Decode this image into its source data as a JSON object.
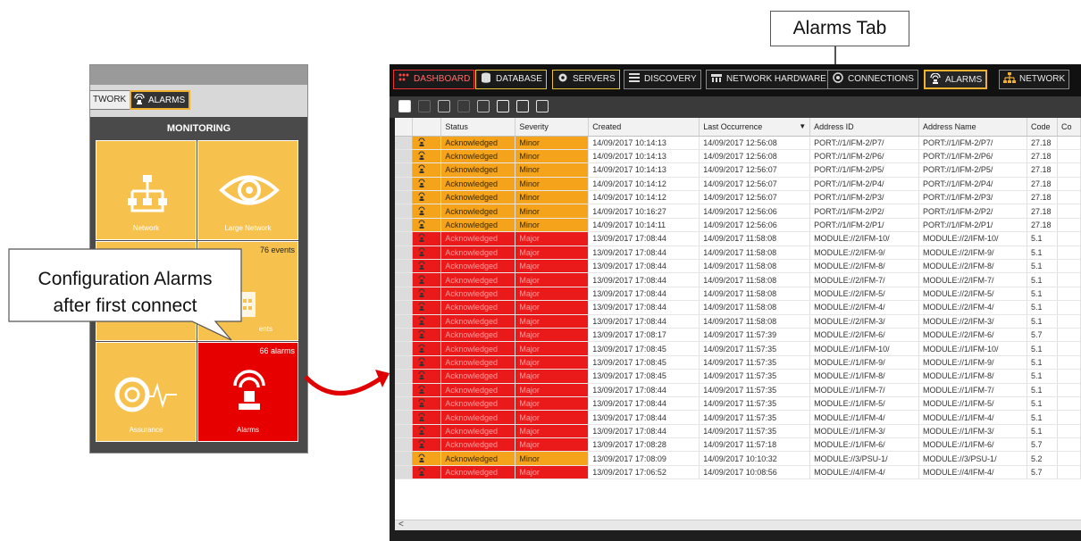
{
  "callouts": {
    "alarms_tab": "Alarms Tab",
    "config_alarms_line1": "Configuration Alarms",
    "config_alarms_line2": "after first connect"
  },
  "left_panel": {
    "tabs": {
      "network": "TWORK",
      "alarms": "ALARMS"
    },
    "section_title": "MONITORING",
    "tiles": [
      {
        "label": "Network",
        "count": "",
        "icon": "network-tree-icon"
      },
      {
        "label": "Large Network",
        "count": "",
        "icon": "eye-icon"
      },
      {
        "label": "",
        "count": "76 events",
        "icon": "calendar-icon"
      },
      {
        "label": "ents",
        "count": "",
        "icon": ""
      },
      {
        "label": "Assurance",
        "count": "",
        "icon": "tire-pulse-icon"
      },
      {
        "label": "Alarms",
        "count": "66 alarms",
        "icon": "siren-icon"
      }
    ]
  },
  "app": {
    "nav": [
      {
        "label": "DASHBOARD",
        "icon": "dashboard-icon"
      },
      {
        "label": "DATABASE",
        "icon": "database-icon"
      },
      {
        "label": "SERVERS",
        "icon": "gear-icon"
      },
      {
        "label": "DISCOVERY",
        "icon": "list-icon"
      },
      {
        "label": "NETWORK HARDWARE",
        "icon": "rack-icon"
      },
      {
        "label": "CONNECTIONS",
        "icon": "connection-icon"
      },
      {
        "label": "ALARMS",
        "icon": "siren-icon"
      },
      {
        "label": "NETWORK",
        "icon": "network-icon"
      }
    ],
    "active_tab": "ALARMS",
    "colors": {
      "minor": "#f5a31a",
      "major": "#ea1a1a",
      "active_border": "#f0b030"
    },
    "table": {
      "columns": [
        "",
        "Status",
        "Severity",
        "Created",
        "Last Occurrence",
        "Address ID",
        "Address Name",
        "Code",
        "Co"
      ],
      "sort_column": "Last Occurrence",
      "rows": [
        [
          "Acknowledged",
          "Minor",
          "14/09/2017 10:14:13",
          "14/09/2017 12:56:08",
          "PORT://1/IFM-2/P7/",
          "PORT://1/IFM-2/P7/",
          "27.18"
        ],
        [
          "Acknowledged",
          "Minor",
          "14/09/2017 10:14:13",
          "14/09/2017 12:56:08",
          "PORT://1/IFM-2/P6/",
          "PORT://1/IFM-2/P6/",
          "27.18"
        ],
        [
          "Acknowledged",
          "Minor",
          "14/09/2017 10:14:13",
          "14/09/2017 12:56:07",
          "PORT://1/IFM-2/P5/",
          "PORT://1/IFM-2/P5/",
          "27.18"
        ],
        [
          "Acknowledged",
          "Minor",
          "14/09/2017 10:14:12",
          "14/09/2017 12:56:07",
          "PORT://1/IFM-2/P4/",
          "PORT://1/IFM-2/P4/",
          "27.18"
        ],
        [
          "Acknowledged",
          "Minor",
          "14/09/2017 10:14:12",
          "14/09/2017 12:56:07",
          "PORT://1/IFM-2/P3/",
          "PORT://1/IFM-2/P3/",
          "27.18"
        ],
        [
          "Acknowledged",
          "Minor",
          "14/09/2017 10:16:27",
          "14/09/2017 12:56:06",
          "PORT://1/IFM-2/P2/",
          "PORT://1/IFM-2/P2/",
          "27.18"
        ],
        [
          "Acknowledged",
          "Minor",
          "14/09/2017 10:14:11",
          "14/09/2017 12:56:06",
          "PORT://1/IFM-2/P1/",
          "PORT://1/IFM-2/P1/",
          "27.18"
        ],
        [
          "Acknowledged",
          "Major",
          "13/09/2017 17:08:44",
          "14/09/2017 11:58:08",
          "MODULE://2/IFM-10/",
          "MODULE://2/IFM-10/",
          "5.1"
        ],
        [
          "Acknowledged",
          "Major",
          "13/09/2017 17:08:44",
          "14/09/2017 11:58:08",
          "MODULE://2/IFM-9/",
          "MODULE://2/IFM-9/",
          "5.1"
        ],
        [
          "Acknowledged",
          "Major",
          "13/09/2017 17:08:44",
          "14/09/2017 11:58:08",
          "MODULE://2/IFM-8/",
          "MODULE://2/IFM-8/",
          "5.1"
        ],
        [
          "Acknowledged",
          "Major",
          "13/09/2017 17:08:44",
          "14/09/2017 11:58:08",
          "MODULE://2/IFM-7/",
          "MODULE://2/IFM-7/",
          "5.1"
        ],
        [
          "Acknowledged",
          "Major",
          "13/09/2017 17:08:44",
          "14/09/2017 11:58:08",
          "MODULE://2/IFM-5/",
          "MODULE://2/IFM-5/",
          "5.1"
        ],
        [
          "Acknowledged",
          "Major",
          "13/09/2017 17:08:44",
          "14/09/2017 11:58:08",
          "MODULE://2/IFM-4/",
          "MODULE://2/IFM-4/",
          "5.1"
        ],
        [
          "Acknowledged",
          "Major",
          "13/09/2017 17:08:44",
          "14/09/2017 11:58:08",
          "MODULE://2/IFM-3/",
          "MODULE://2/IFM-3/",
          "5.1"
        ],
        [
          "Acknowledged",
          "Major",
          "13/09/2017 17:08:17",
          "14/09/2017 11:57:39",
          "MODULE://2/IFM-6/",
          "MODULE://2/IFM-6/",
          "5.7"
        ],
        [
          "Acknowledged",
          "Major",
          "13/09/2017 17:08:45",
          "14/09/2017 11:57:35",
          "MODULE://1/IFM-10/",
          "MODULE://1/IFM-10/",
          "5.1"
        ],
        [
          "Acknowledged",
          "Major",
          "13/09/2017 17:08:45",
          "14/09/2017 11:57:35",
          "MODULE://1/IFM-9/",
          "MODULE://1/IFM-9/",
          "5.1"
        ],
        [
          "Acknowledged",
          "Major",
          "13/09/2017 17:08:45",
          "14/09/2017 11:57:35",
          "MODULE://1/IFM-8/",
          "MODULE://1/IFM-8/",
          "5.1"
        ],
        [
          "Acknowledged",
          "Major",
          "13/09/2017 17:08:44",
          "14/09/2017 11:57:35",
          "MODULE://1/IFM-7/",
          "MODULE://1/IFM-7/",
          "5.1"
        ],
        [
          "Acknowledged",
          "Major",
          "13/09/2017 17:08:44",
          "14/09/2017 11:57:35",
          "MODULE://1/IFM-5/",
          "MODULE://1/IFM-5/",
          "5.1"
        ],
        [
          "Acknowledged",
          "Major",
          "13/09/2017 17:08:44",
          "14/09/2017 11:57:35",
          "MODULE://1/IFM-4/",
          "MODULE://1/IFM-4/",
          "5.1"
        ],
        [
          "Acknowledged",
          "Major",
          "13/09/2017 17:08:44",
          "14/09/2017 11:57:35",
          "MODULE://1/IFM-3/",
          "MODULE://1/IFM-3/",
          "5.1"
        ],
        [
          "Acknowledged",
          "Major",
          "13/09/2017 17:08:28",
          "14/09/2017 11:57:18",
          "MODULE://1/IFM-6/",
          "MODULE://1/IFM-6/",
          "5.7"
        ],
        [
          "Acknowledged",
          "Minor",
          "13/09/2017 17:08:09",
          "14/09/2017 10:10:32",
          "MODULE://3/PSU-1/",
          "MODULE://3/PSU-1/",
          "5.2"
        ],
        [
          "Acknowledged",
          "Major",
          "13/09/2017 17:06:52",
          "14/09/2017 10:08:56",
          "MODULE://4/IFM-4/",
          "MODULE://4/IFM-4/",
          "5.7"
        ]
      ]
    },
    "scroll_arrow": "<"
  }
}
